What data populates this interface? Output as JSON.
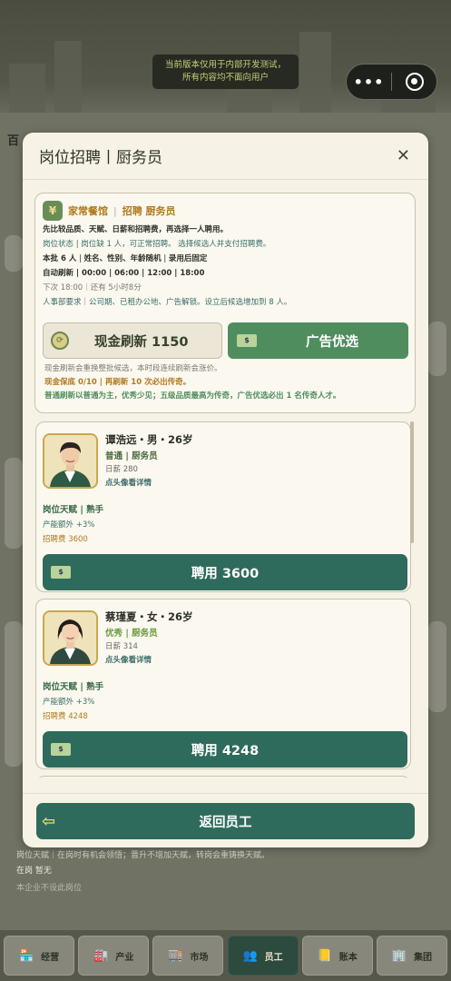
{
  "notice": {
    "line1": "当前版本仅用于内部开发测试，",
    "line2": "所有内容均不面向用户"
  },
  "capsule": {
    "more": "•••"
  },
  "background": {
    "title_fragment": "百",
    "footer_text": "岗位天赋｜在岗时有机会领悟；晋升不增加天赋，转岗会重铸换天赋。",
    "status_on": "在岗 暂无",
    "status_note": "本企业不设此岗位"
  },
  "modal": {
    "title": "岗位招聘丨厨务员",
    "close": "✕",
    "info": {
      "shop": "家常餐馆",
      "role": "招聘 厨务员",
      "desc": "先比较品质、天赋、日薪和招聘费，再选择一人聘用。",
      "status_label": "岗位状态",
      "status_value": "岗位缺 1 人，可正常招聘。 选择候选人并支付招聘费。",
      "batch_label": "本批 6 人",
      "batch_value": "姓名、性别、年龄随机",
      "batch_fixed": "录用后固定",
      "auto_label": "自动刷新",
      "times": [
        "00:00",
        "06:00",
        "12:00",
        "18:00"
      ],
      "next_refresh": "下次 18:00｜还有 5小时8分",
      "hr_note": "人事部要求｜公司期、已租办公地、广告解锁。设立后候选增加到 8 人。",
      "refresh_btn": "现金刷新 1150",
      "ad_btn": "广告优选",
      "note_cash": "现金刷新会重换整批候选，本时段连续刷新会涨价。",
      "note_pity_label": "现金保底 0/10",
      "note_pity_value": "再刷新 10 次必出传奇。",
      "note_normal": "普通刷新以普通为主，优秀少见；五级品质最高为传奇，广告优选必出 1 名传奇人才。"
    },
    "candidates": [
      {
        "name": "谭浩远・男・26岁",
        "grade": "普通",
        "role": "厨务员",
        "wage": "日薪 280",
        "link": "点头像看详情",
        "talent_label": "岗位天赋",
        "talent_value": "熟手",
        "bonus": "产能额外 +3%",
        "fee": "招聘费 3600",
        "hire": "聘用 3600"
      },
      {
        "name": "蔡瑾夏・女・26岁",
        "grade": "优秀",
        "role": "厨务员",
        "wage": "日薪 314",
        "link": "点头像看详情",
        "talent_label": "岗位天赋",
        "talent_value": "熟手",
        "bonus": "产能额外 +3%",
        "fee": "招聘费 4248",
        "hire": "聘用 4248"
      }
    ],
    "back": "返回员工"
  },
  "nav": [
    {
      "label": "经营",
      "icon": "🏪"
    },
    {
      "label": "产业",
      "icon": "🏭"
    },
    {
      "label": "市场",
      "icon": "🏬"
    },
    {
      "label": "员工",
      "icon": "👥"
    },
    {
      "label": "账本",
      "icon": "📒"
    },
    {
      "label": "集团",
      "icon": "🏢"
    }
  ],
  "colors": {
    "primary": "#2f6b5c",
    "ad": "#4f8d5f",
    "gold": "#b07a1e",
    "modal_bg": "#f6f2e5"
  }
}
